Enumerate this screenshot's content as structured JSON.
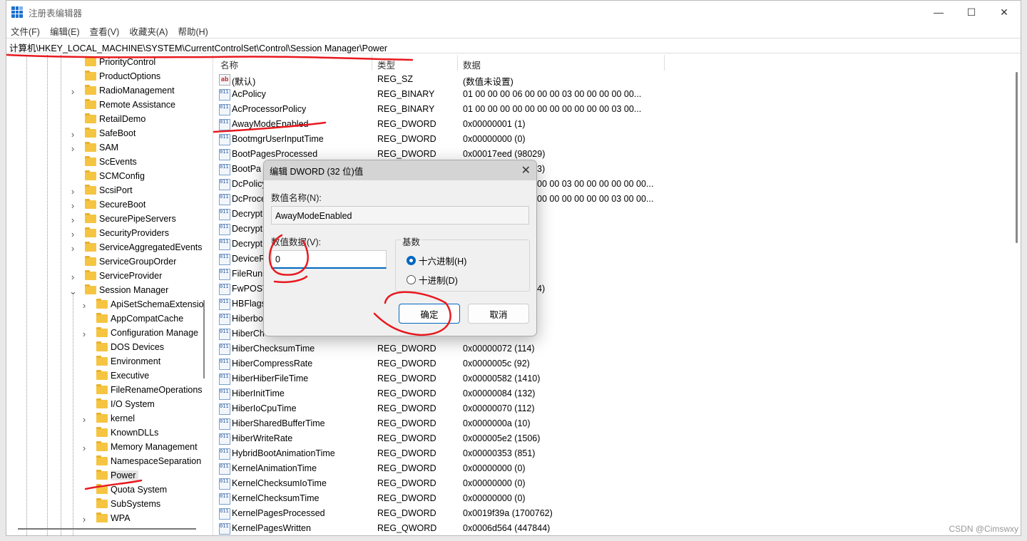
{
  "window": {
    "title": "注册表编辑器",
    "controls": [
      "—",
      "☐",
      "✕"
    ]
  },
  "menu": [
    "文件(F)",
    "编辑(E)",
    "查看(V)",
    "收藏夹(A)",
    "帮助(H)"
  ],
  "address": "计算机\\HKEY_LOCAL_MACHINE\\SYSTEM\\CurrentControlSet\\Control\\Session Manager\\Power",
  "tree": [
    {
      "label": "PriorityControl",
      "level": 1,
      "expandable": false
    },
    {
      "label": "ProductOptions",
      "level": 1,
      "expandable": false
    },
    {
      "label": "RadioManagement",
      "level": 1,
      "expandable": true
    },
    {
      "label": "Remote Assistance",
      "level": 1,
      "expandable": false
    },
    {
      "label": "RetailDemo",
      "level": 1,
      "expandable": false
    },
    {
      "label": "SafeBoot",
      "level": 1,
      "expandable": true
    },
    {
      "label": "SAM",
      "level": 1,
      "expandable": true
    },
    {
      "label": "ScEvents",
      "level": 1,
      "expandable": false
    },
    {
      "label": "SCMConfig",
      "level": 1,
      "expandable": false
    },
    {
      "label": "ScsiPort",
      "level": 1,
      "expandable": true
    },
    {
      "label": "SecureBoot",
      "level": 1,
      "expandable": true
    },
    {
      "label": "SecurePipeServers",
      "level": 1,
      "expandable": true
    },
    {
      "label": "SecurityProviders",
      "level": 1,
      "expandable": true
    },
    {
      "label": "ServiceAggregatedEvents",
      "level": 1,
      "expandable": true
    },
    {
      "label": "ServiceGroupOrder",
      "level": 1,
      "expandable": false
    },
    {
      "label": "ServiceProvider",
      "level": 1,
      "expandable": true
    },
    {
      "label": "Session Manager",
      "level": 1,
      "expandable": true,
      "expanded": true
    },
    {
      "label": "ApiSetSchemaExtensio",
      "level": 2,
      "expandable": true
    },
    {
      "label": "AppCompatCache",
      "level": 2,
      "expandable": false
    },
    {
      "label": "Configuration Manage",
      "level": 2,
      "expandable": true
    },
    {
      "label": "DOS Devices",
      "level": 2,
      "expandable": false
    },
    {
      "label": "Environment",
      "level": 2,
      "expandable": false
    },
    {
      "label": "Executive",
      "level": 2,
      "expandable": false
    },
    {
      "label": "FileRenameOperations",
      "level": 2,
      "expandable": false
    },
    {
      "label": "I/O System",
      "level": 2,
      "expandable": false
    },
    {
      "label": "kernel",
      "level": 2,
      "expandable": true
    },
    {
      "label": "KnownDLLs",
      "level": 2,
      "expandable": false
    },
    {
      "label": "Memory Management",
      "level": 2,
      "expandable": true
    },
    {
      "label": "NamespaceSeparation",
      "level": 2,
      "expandable": false
    },
    {
      "label": "Power",
      "level": 2,
      "expandable": false,
      "selected": true
    },
    {
      "label": "Quota System",
      "level": 2,
      "expandable": false
    },
    {
      "label": "SubSystems",
      "level": 2,
      "expandable": false
    },
    {
      "label": "WPA",
      "level": 2,
      "expandable": true
    }
  ],
  "list": {
    "headers": [
      "名称",
      "类型",
      "数据"
    ],
    "rows": [
      {
        "name": "(默认)",
        "type": "REG_SZ",
        "data": "(数值未设置)",
        "icon": "string"
      },
      {
        "name": "AcPolicy",
        "type": "REG_BINARY",
        "data": "01 00 00 00 06 00 00 00 03 00 00 00 00 00...",
        "icon": "binary"
      },
      {
        "name": "AcProcessorPolicy",
        "type": "REG_BINARY",
        "data": "01 00 00 00 00 00 00 00 00 00 00 00 03 00...",
        "icon": "binary"
      },
      {
        "name": "AwayModeEnabled",
        "type": "REG_DWORD",
        "data": "0x00000001 (1)",
        "icon": "binary"
      },
      {
        "name": "BootmgrUserInputTime",
        "type": "REG_DWORD",
        "data": "0x00000000 (0)",
        "icon": "binary"
      },
      {
        "name": "BootPagesProcessed",
        "type": "REG_DWORD",
        "data": "0x00017eed (98029)",
        "icon": "binary"
      },
      {
        "name": "BootPa",
        "type": "",
        "data": "3)",
        "icon": "binary",
        "partial": true
      },
      {
        "name": "DcPolicy",
        "type": "",
        "data": "00 00 03 00 00 00 00 00 00...",
        "icon": "binary",
        "partial": true
      },
      {
        "name": "DcProce",
        "type": "",
        "data": "00 00 00 00 00 00 03 00 00...",
        "icon": "binary",
        "partial": true
      },
      {
        "name": "Decrypt",
        "type": "",
        "data": "",
        "icon": "binary",
        "partial": true
      },
      {
        "name": "Decrypt",
        "type": "",
        "data": "",
        "icon": "binary",
        "partial": true
      },
      {
        "name": "Decrypt",
        "type": "",
        "data": "",
        "icon": "binary",
        "partial": true
      },
      {
        "name": "DeviceR",
        "type": "",
        "data": "",
        "icon": "binary",
        "partial": true
      },
      {
        "name": "FileRuns",
        "type": "",
        "data": "",
        "icon": "binary",
        "partial": true
      },
      {
        "name": "FwPOST",
        "type": "",
        "data": "4)",
        "icon": "binary",
        "partial": true
      },
      {
        "name": "HBFlags",
        "type": "",
        "data": "",
        "icon": "binary",
        "partial": true
      },
      {
        "name": "Hiberbo",
        "type": "",
        "data": "",
        "icon": "binary",
        "partial": true
      },
      {
        "name": "HiberCh",
        "type": "",
        "data": "",
        "icon": "binary",
        "partial": true
      },
      {
        "name": "HiberChecksumTime",
        "type": "REG_DWORD",
        "data": "0x00000072 (114)",
        "icon": "binary"
      },
      {
        "name": "HiberCompressRate",
        "type": "REG_DWORD",
        "data": "0x0000005c (92)",
        "icon": "binary"
      },
      {
        "name": "HiberHiberFileTime",
        "type": "REG_DWORD",
        "data": "0x00000582 (1410)",
        "icon": "binary"
      },
      {
        "name": "HiberInitTime",
        "type": "REG_DWORD",
        "data": "0x00000084 (132)",
        "icon": "binary"
      },
      {
        "name": "HiberIoCpuTime",
        "type": "REG_DWORD",
        "data": "0x00000070 (112)",
        "icon": "binary"
      },
      {
        "name": "HiberSharedBufferTime",
        "type": "REG_DWORD",
        "data": "0x0000000a (10)",
        "icon": "binary"
      },
      {
        "name": "HiberWriteRate",
        "type": "REG_DWORD",
        "data": "0x000005e2 (1506)",
        "icon": "binary"
      },
      {
        "name": "HybridBootAnimationTime",
        "type": "REG_DWORD",
        "data": "0x00000353 (851)",
        "icon": "binary"
      },
      {
        "name": "KernelAnimationTime",
        "type": "REG_DWORD",
        "data": "0x00000000 (0)",
        "icon": "binary"
      },
      {
        "name": "KernelChecksumIoTime",
        "type": "REG_DWORD",
        "data": "0x00000000 (0)",
        "icon": "binary"
      },
      {
        "name": "KernelChecksumTime",
        "type": "REG_DWORD",
        "data": "0x00000000 (0)",
        "icon": "binary"
      },
      {
        "name": "KernelPagesProcessed",
        "type": "REG_DWORD",
        "data": "0x0019f39a (1700762)",
        "icon": "binary"
      },
      {
        "name": "KernelPagesWritten",
        "type": "REG_QWORD",
        "data": "0x0006d564 (447844)",
        "icon": "binary"
      }
    ]
  },
  "dialog": {
    "title": "编辑 DWORD (32 位)值",
    "name_label": "数值名称(N):",
    "name_value": "AwayModeEnabled",
    "data_label": "数值数据(V):",
    "data_value": "0",
    "base_label": "基数",
    "hex_label": "十六进制(H)",
    "dec_label": "十进制(D)",
    "base_selected": "hex",
    "ok": "确定",
    "cancel": "取消"
  },
  "watermark": "CSDN @Cimswxy",
  "colors": {
    "accent": "#0067c0",
    "annotation": "#e8191f"
  }
}
